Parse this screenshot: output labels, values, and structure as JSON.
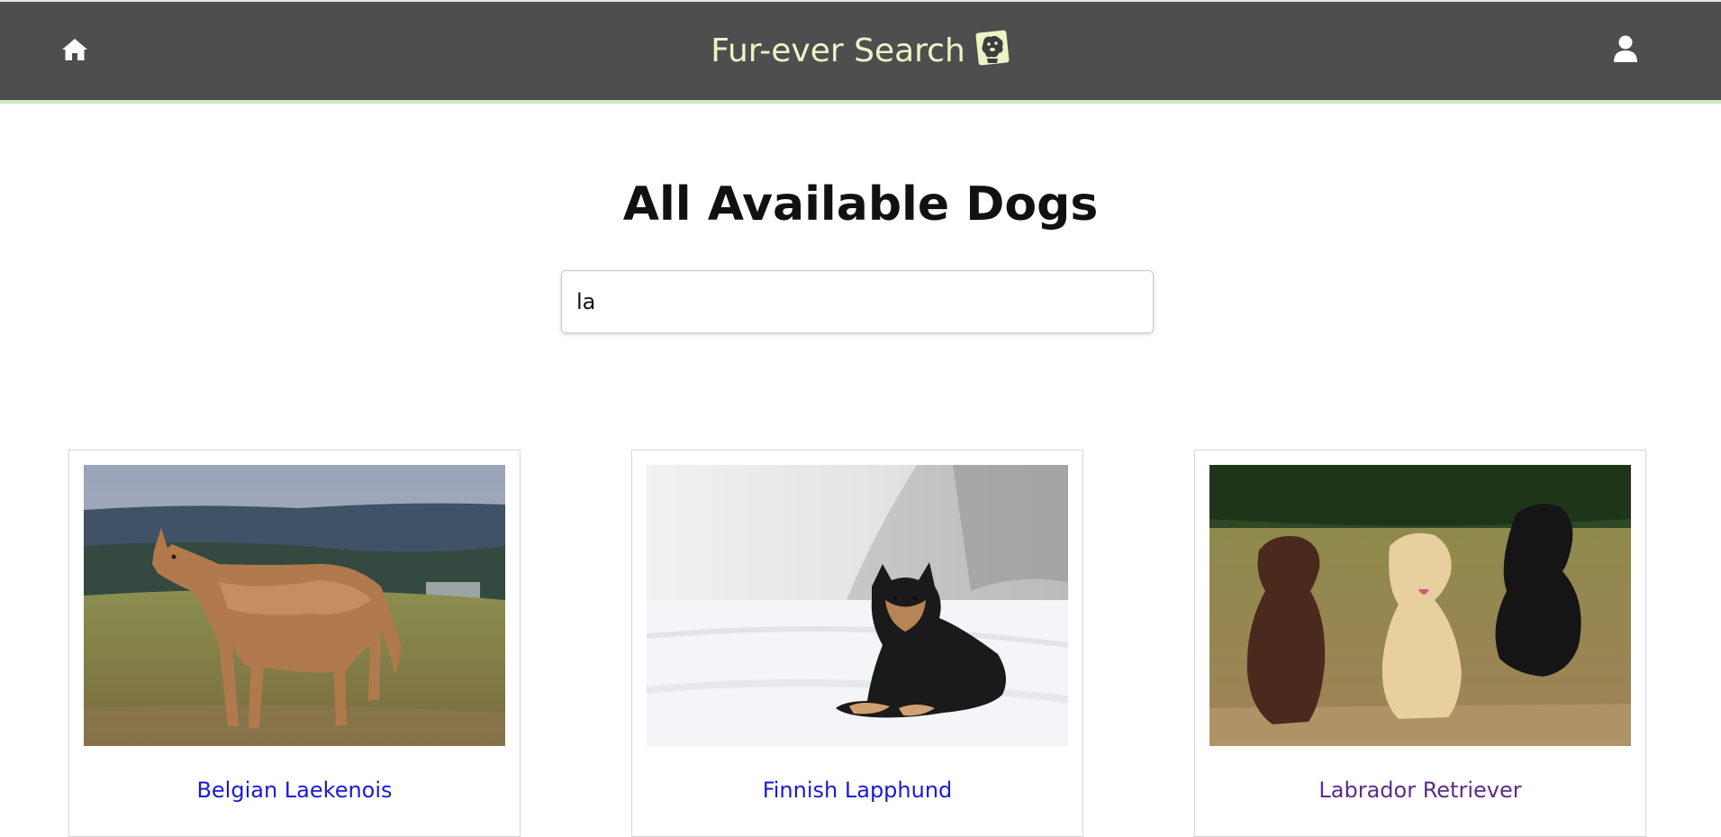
{
  "header": {
    "brand_title": "Fur-ever Search",
    "home_icon": "home-icon",
    "user_icon": "user-icon",
    "logo_icon": "dog-logo-icon",
    "background_color": "#4e4e4e",
    "brand_color": "#e9f5c6",
    "accent_border_color": "#cfe8c6"
  },
  "main": {
    "title": "All Available Dogs",
    "search": {
      "value": "la",
      "placeholder": ""
    }
  },
  "dogs": [
    {
      "name": "Belgian Laekenois",
      "link_state": "unvisited",
      "link_color": "#1a1ad6"
    },
    {
      "name": "Finnish Lapphund",
      "link_state": "unvisited",
      "link_color": "#1a1ad6"
    },
    {
      "name": "Labrador Retriever",
      "link_state": "visited",
      "link_color": "#5a2d86"
    }
  ]
}
